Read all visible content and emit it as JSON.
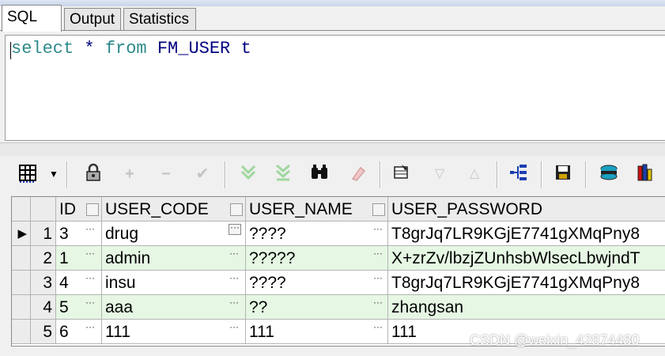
{
  "tabs": [
    "SQL",
    "Output",
    "Statistics"
  ],
  "editor": {
    "keyword_select": "select",
    "star": "*",
    "keyword_from": "from",
    "table": "FM_USER",
    "alias": "t",
    "colors": {
      "keyword": "#2e8b8b",
      "identifier": "#000080"
    }
  },
  "toolbar": {
    "icons": [
      "grid-layout-icon",
      "dropdown-arrow-icon",
      "lock-icon",
      "add-record-icon",
      "delete-record-icon",
      "post-changes-icon",
      "fetch-next-icon",
      "fetch-last-icon",
      "find-binoculars-icon",
      "clear-icon",
      "query-by-example-icon",
      "previous-icon",
      "next-icon",
      "tree-icon",
      "save-icon",
      "export-icon",
      "chart-icon"
    ]
  },
  "grid": {
    "columns": [
      "ID",
      "USER_CODE",
      "USER_NAME",
      "USER_PASSWORD"
    ],
    "rows": [
      {
        "num": "1",
        "id": "3",
        "code": "drug",
        "name": "????",
        "password": "T8grJq7LR9KGjE7741gXMqPny8"
      },
      {
        "num": "2",
        "id": "1",
        "code": "admin",
        "name": "?????",
        "password": "X+zrZv/lbzjZUnhsbWlsecLbwjndT"
      },
      {
        "num": "3",
        "id": "4",
        "code": "insu",
        "name": "????",
        "password": "T8grJq7LR9KGjE7741gXMqPny8"
      },
      {
        "num": "4",
        "id": "5",
        "code": "aaa",
        "name": "??",
        "password": "zhangsan"
      },
      {
        "num": "5",
        "id": "6",
        "code": "111",
        "name": "111",
        "password": "111"
      }
    ],
    "current_row_marker": "▶",
    "ellipsis": "···",
    "colors": {
      "alt_row": "#e6f7e4"
    }
  },
  "watermark": "CSDN @weixin_42874480"
}
